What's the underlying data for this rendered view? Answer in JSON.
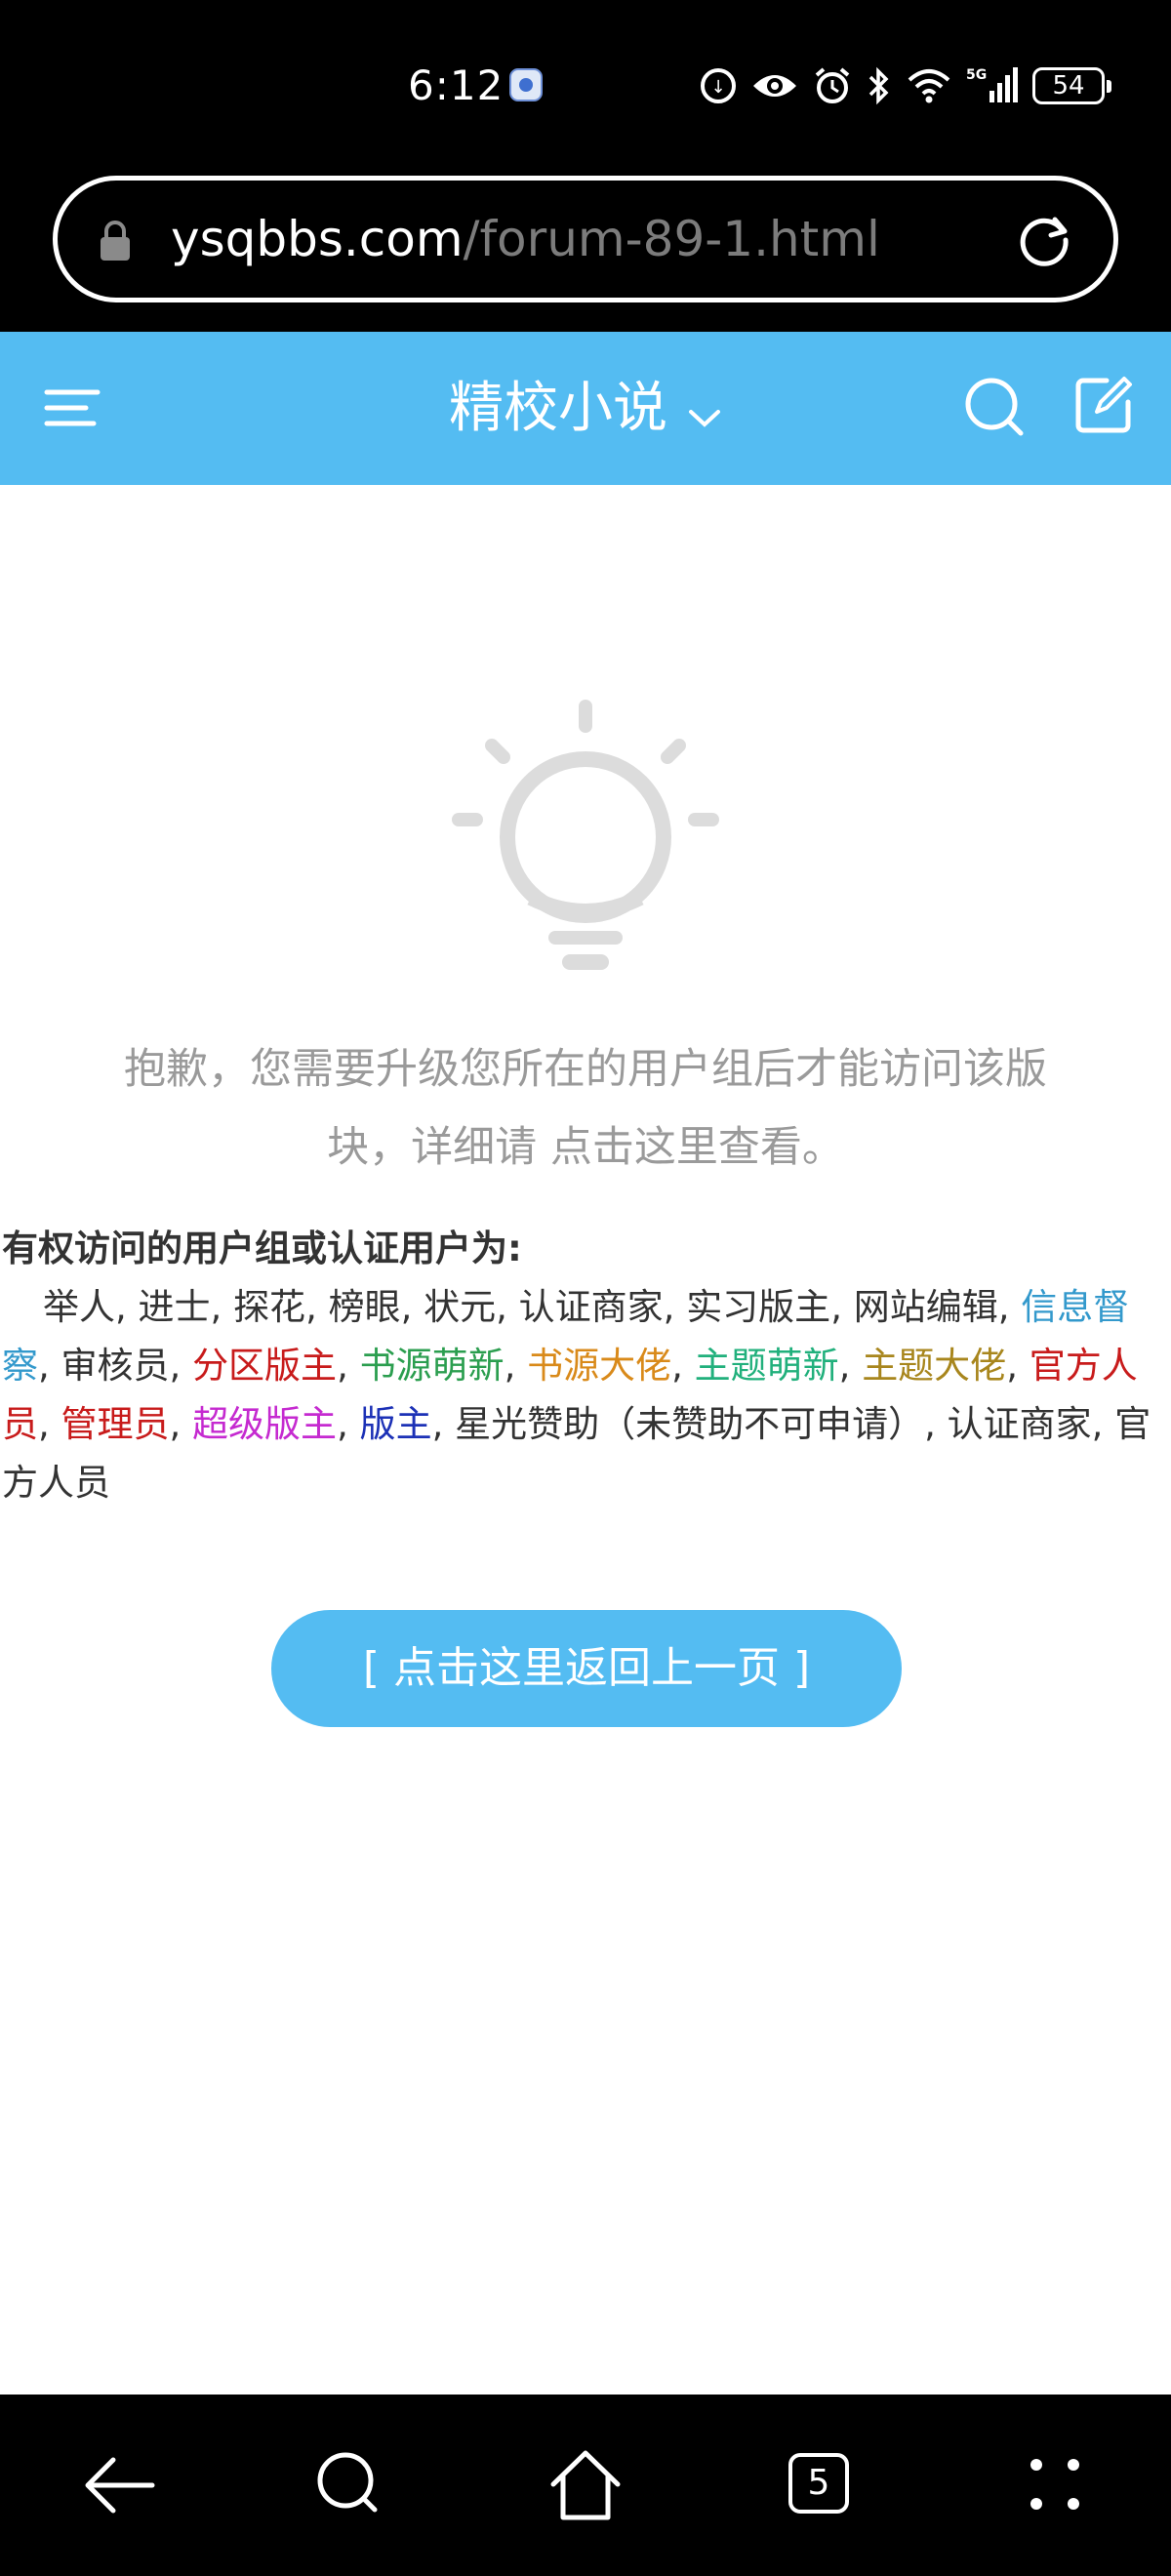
{
  "status_bar": {
    "time": "6:12",
    "battery_level": "54",
    "icons": [
      "notification-app-icon",
      "data-saver-icon",
      "eye-comfort-icon",
      "alarm-icon",
      "bluetooth-icon",
      "wifi-icon",
      "signal-5g-icon",
      "battery-icon"
    ]
  },
  "address_bar": {
    "host": "ysqbbs.com",
    "path": "/forum-89-1.html"
  },
  "header": {
    "title": "精校小说"
  },
  "notice": {
    "message": "抱歉，您需要升级您所在的用户组后才能访问该版块，详细请 点击这里查看。"
  },
  "permissions": {
    "title": "有权访问的用户组或认证用户为:",
    "groups": [
      {
        "name": "举人",
        "color": "#333333"
      },
      {
        "name": "进士",
        "color": "#333333"
      },
      {
        "name": "探花",
        "color": "#333333"
      },
      {
        "name": "榜眼",
        "color": "#333333"
      },
      {
        "name": "状元",
        "color": "#333333"
      },
      {
        "name": "认证商家",
        "color": "#333333"
      },
      {
        "name": "实习版主",
        "color": "#333333"
      },
      {
        "name": "网站编辑",
        "color": "#333333"
      },
      {
        "name": "信息督察",
        "color": "#3399cc"
      },
      {
        "name": "审核员",
        "color": "#333333"
      },
      {
        "name": "分区版主",
        "color": "#c81b1b"
      },
      {
        "name": "书源萌新",
        "color": "#2b9e4f"
      },
      {
        "name": "书源大佬",
        "color": "#d98a1a"
      },
      {
        "name": "主题萌新",
        "color": "#21b07c"
      },
      {
        "name": "主题大佬",
        "color": "#a8861d"
      },
      {
        "name": "官方人员",
        "color": "#c81b1b"
      },
      {
        "name": "管理员",
        "color": "#c81b1b"
      },
      {
        "name": "超级版主",
        "color": "#c52ad0"
      },
      {
        "name": "版主",
        "color": "#1c31b6"
      },
      {
        "name": "星光赞助（未赞助不可申请）",
        "color": "#333333"
      },
      {
        "name": "认证商家",
        "color": "#333333"
      },
      {
        "name": "官方人员",
        "color": "#333333"
      }
    ]
  },
  "back_button": {
    "label": "[ 点击这里返回上一页 ]"
  },
  "bottom_nav": {
    "tab_count": "5",
    "items": [
      "back-icon",
      "search-icon",
      "home-icon",
      "tabs-icon",
      "more-icon"
    ]
  },
  "colors": {
    "brand": "#54bcf2",
    "notice_text": "#9a9a9a"
  }
}
